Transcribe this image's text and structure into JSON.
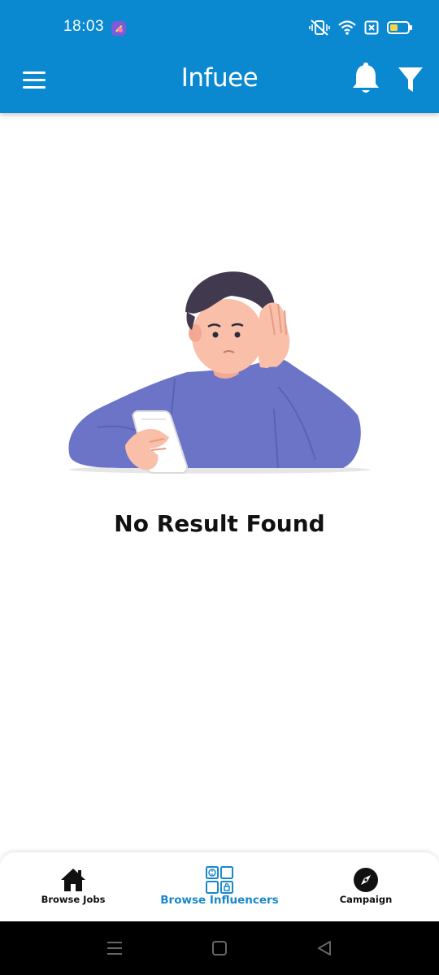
{
  "status_bar": {
    "time": "18:03"
  },
  "app_bar": {
    "title": "Infuee",
    "icons": [
      "hamburger-menu-icon",
      "bell-icon",
      "filter-icon"
    ],
    "background_color": "#0a88d0"
  },
  "empty_state": {
    "message": "No Result Found"
  },
  "bottom_nav": {
    "items": [
      {
        "label": "Browse Jobs",
        "icon": "home-icon",
        "active": false
      },
      {
        "label": "Browse Influencers",
        "icon": "influencers-grid-icon",
        "active": true
      },
      {
        "label": "Campaign",
        "icon": "compass-icon",
        "active": false
      }
    ],
    "active_color": "#1a88c9"
  },
  "system_nav": {
    "buttons": [
      "recents-icon",
      "home-square-icon",
      "back-triangle-icon"
    ]
  }
}
